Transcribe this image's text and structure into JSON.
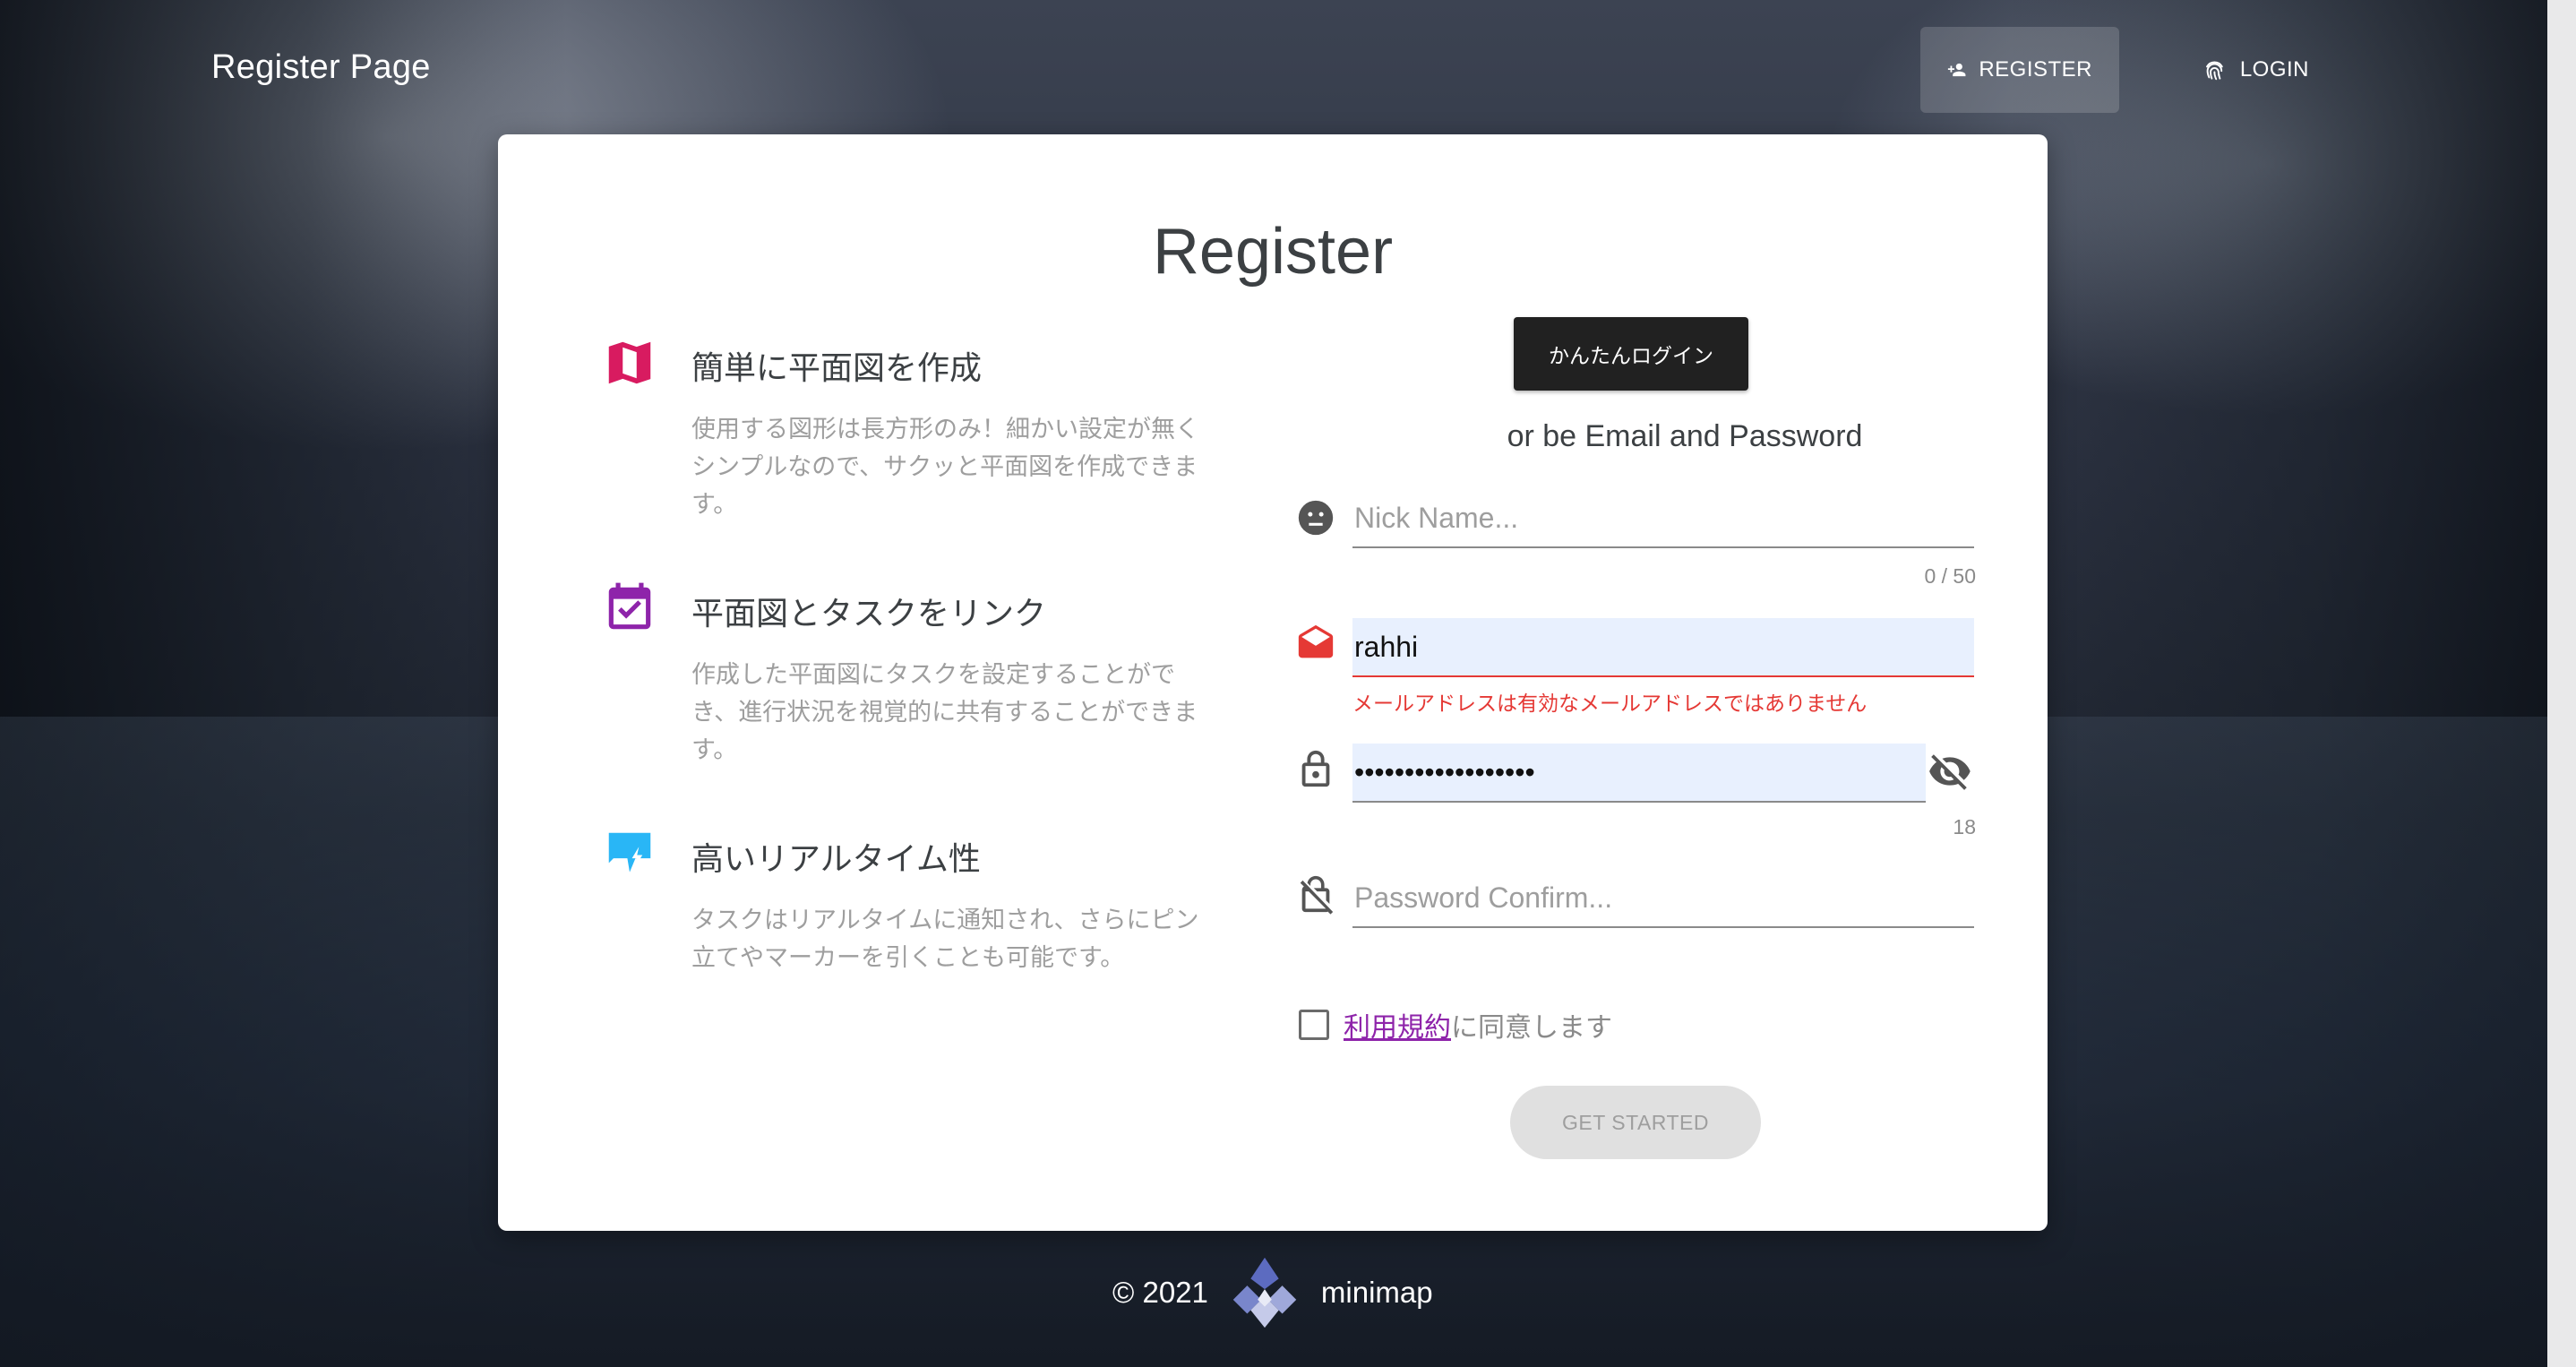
{
  "header": {
    "brand": "Register Page",
    "nav": [
      {
        "label": "REGISTER",
        "icon": "person-add-icon"
      },
      {
        "label": "LOGIN",
        "icon": "fingerprint-icon"
      }
    ]
  },
  "card": {
    "title": "Register",
    "features": [
      {
        "icon": "map-icon",
        "color": "#d81b60",
        "title": "簡単に平面図を作成",
        "desc": "使用する図形は長方形のみ！細かい設定が無くシンプルなので、サクッと平面図を作成できます。"
      },
      {
        "icon": "calendar-check-icon",
        "color": "#8e24aa",
        "title": "平面図とタスクをリンク",
        "desc": "作成した平面図にタスクを設定することができ、進行状況を視覚的に共有することができます。"
      },
      {
        "icon": "chat-flash-icon",
        "color": "#29b6f6",
        "title": "高いリアルタイム性",
        "desc": "タスクはリアルタイムに通知され、さらにピン立てやマーカーを引くことも可能です。"
      }
    ],
    "easy_login_label": "かんたんログイン",
    "or_text": "or be Email and Password",
    "form": {
      "nickname": {
        "placeholder": "Nick Name...",
        "value": "",
        "counter": "0 / 50",
        "icon": "face-icon"
      },
      "email": {
        "value": "rahhi",
        "error": "メールアドレスは有効なメールアドレスではありません",
        "icon": "email-open-icon",
        "icon_color": "#e53935"
      },
      "password": {
        "value": "••••••••••••••••••",
        "counter": "18",
        "icon": "lock-icon",
        "toggle_icon": "eye-off-icon"
      },
      "password_confirm": {
        "placeholder": "Password Confirm...",
        "value": "",
        "icon": "lock-off-icon"
      },
      "terms_link": "利用規約",
      "terms_suffix": "に同意します",
      "submit_label": "GET STARTED"
    }
  },
  "footer": {
    "copyright": "© 2021",
    "app_name": "minimap",
    "logo": "minimap-logo"
  }
}
